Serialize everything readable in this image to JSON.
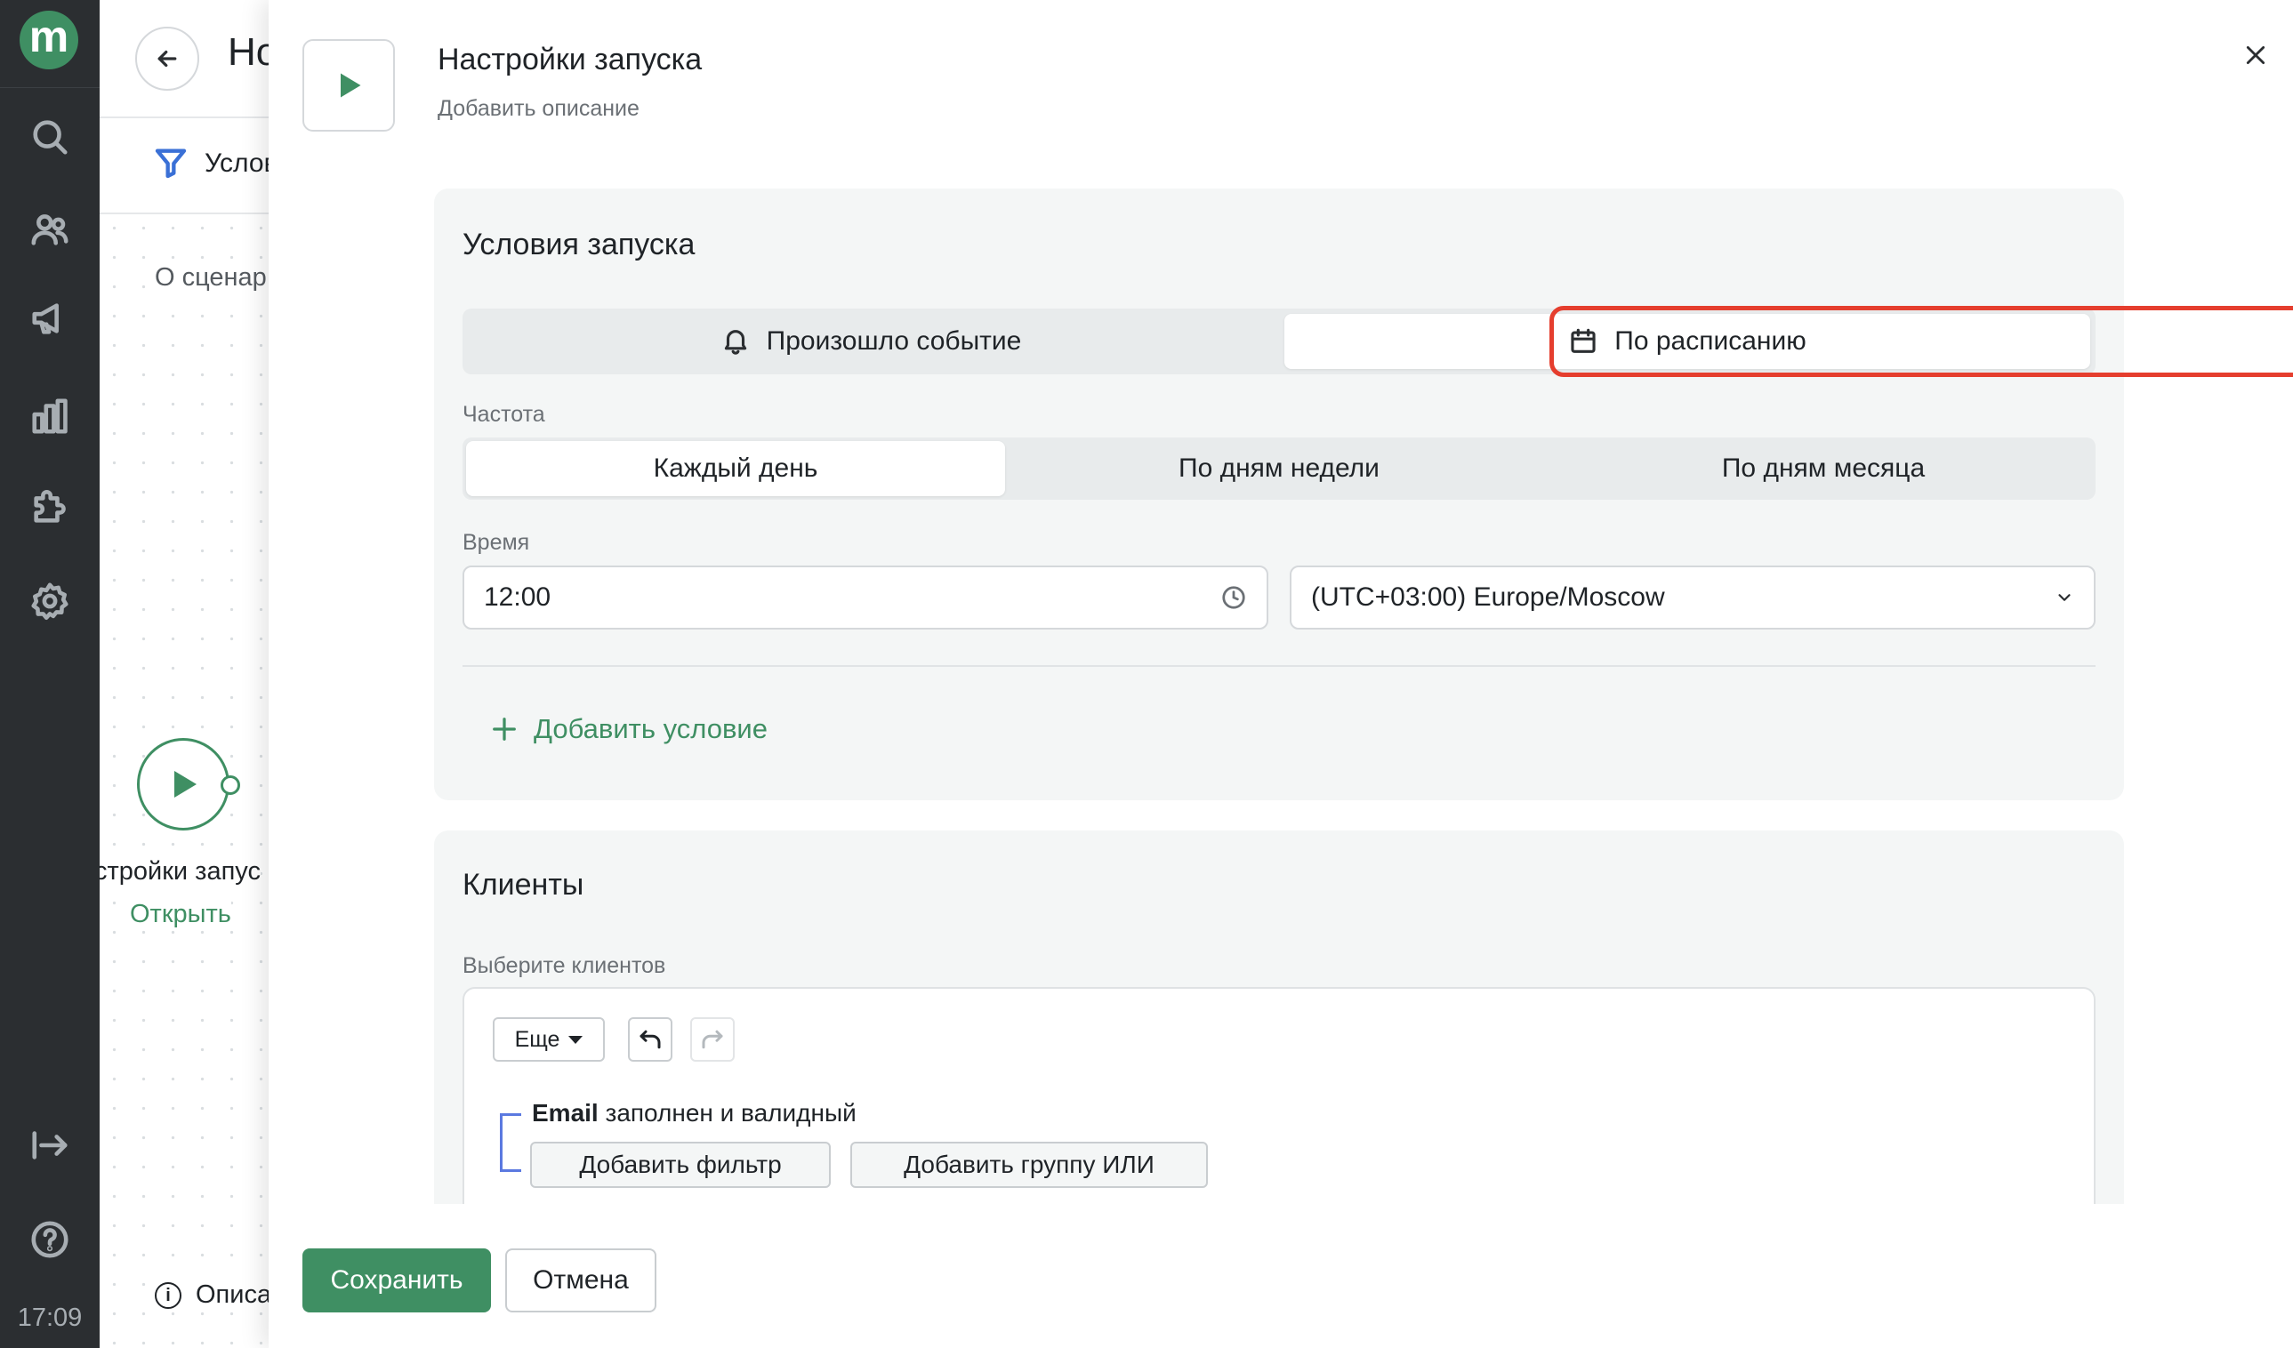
{
  "rail": {
    "logo_letter": "m",
    "time": "17:09",
    "icons": [
      "search-icon",
      "users-icon",
      "megaphone-icon",
      "chart-icon",
      "puzzle-icon",
      "gear-icon",
      "collapse-icon",
      "help-icon"
    ]
  },
  "background": {
    "title": "Но",
    "tab_label": "Услов",
    "about": "О сценар",
    "node_label": "стройки запус",
    "node_open": "Открыть",
    "footer_label": "Описа"
  },
  "modal": {
    "title": "Настройки запуска",
    "description": "Добавить описание",
    "launch_conditions": {
      "title": "Условия запуска",
      "trigger_options": [
        "Произошло событие",
        "По расписанию"
      ],
      "selected_trigger": "По расписанию",
      "frequency_label": "Частота",
      "frequency_options": [
        "Каждый день",
        "По дням недели",
        "По дням месяца"
      ],
      "selected_frequency": "Каждый день",
      "time_label": "Время",
      "time_value": "12:00",
      "timezone_value": "(UTC+03:00) Europe/Moscow",
      "add_condition": "Добавить условие"
    },
    "clients": {
      "title": "Клиенты",
      "select_label": "Выберите клиентов",
      "more_button": "Еще",
      "condition_field": "Email",
      "condition_text": " заполнен и валидный",
      "add_filter": "Добавить фильтр",
      "add_or_group": "Добавить группу ИЛИ"
    },
    "footer": {
      "save": "Сохранить",
      "cancel": "Отмена"
    }
  },
  "colors": {
    "accent": "#3f8f63",
    "rail_bg": "#2b2e31",
    "highlight": "#e53e2e",
    "group_bracket": "#5b79e0"
  }
}
